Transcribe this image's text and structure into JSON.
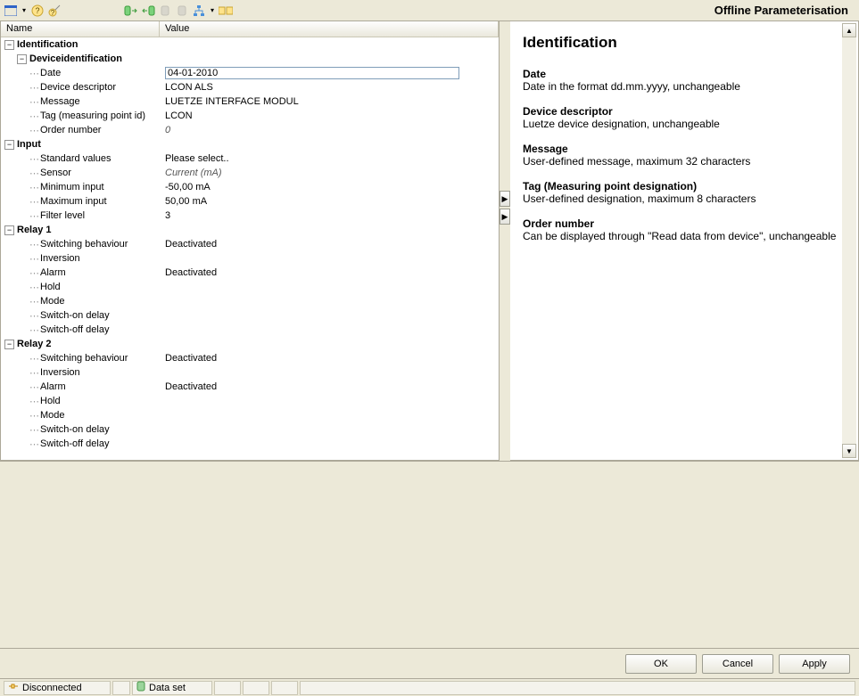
{
  "window": {
    "title": "Offline Parameterisation"
  },
  "columns": {
    "name": "Name",
    "value": "Value"
  },
  "tree": {
    "identification": {
      "label": "Identification",
      "devid": {
        "label": "Deviceidentification",
        "date": {
          "label": "Date",
          "value": "04-01-2010"
        },
        "descriptor": {
          "label": "Device descriptor",
          "value": "LCON ALS"
        },
        "message": {
          "label": "Message",
          "value": "LUETZE INTERFACE MODUL"
        },
        "tag": {
          "label": "Tag (measuring point id)",
          "value": "LCON"
        },
        "order": {
          "label": "Order number",
          "value": "0"
        }
      }
    },
    "input": {
      "label": "Input",
      "std": {
        "label": "Standard values",
        "value": "Please select.."
      },
      "sensor": {
        "label": "Sensor",
        "value": "Current (mA)"
      },
      "min": {
        "label": "Minimum input",
        "value": "-50,00 mA"
      },
      "max": {
        "label": "Maximum input",
        "value": "50,00 mA"
      },
      "filter": {
        "label": "Filter level",
        "value": "3"
      }
    },
    "relay1": {
      "label": "Relay 1",
      "switching": {
        "label": "Switching behaviour",
        "value": "Deactivated"
      },
      "inversion": {
        "label": "Inversion",
        "value": ""
      },
      "alarm": {
        "label": "Alarm",
        "value": "Deactivated"
      },
      "hold": {
        "label": "Hold",
        "value": ""
      },
      "mode": {
        "label": "Mode",
        "value": ""
      },
      "ondelay": {
        "label": "Switch-on delay",
        "value": ""
      },
      "offdelay": {
        "label": "Switch-off delay",
        "value": ""
      }
    },
    "relay2": {
      "label": "Relay 2",
      "switching": {
        "label": "Switching behaviour",
        "value": "Deactivated"
      },
      "inversion": {
        "label": "Inversion",
        "value": ""
      },
      "alarm": {
        "label": "Alarm",
        "value": "Deactivated"
      },
      "hold": {
        "label": "Hold",
        "value": ""
      },
      "mode": {
        "label": "Mode",
        "value": ""
      },
      "ondelay": {
        "label": "Switch-on delay",
        "value": ""
      },
      "offdelay": {
        "label": "Switch-off delay",
        "value": ""
      }
    }
  },
  "help": {
    "heading": "Identification",
    "items": {
      "date": {
        "title": "Date",
        "body": "Date in the format dd.mm.yyyy, unchangeable"
      },
      "descriptor": {
        "title": "Device descriptor",
        "body": "Luetze device designation, unchangeable"
      },
      "message": {
        "title": "Message",
        "body": "User-defined message, maximum 32 characters"
      },
      "tag": {
        "title": "Tag (Measuring point designation)",
        "body": "User-defined designation, maximum 8 characters"
      },
      "order": {
        "title": "Order number",
        "body": "Can be displayed through \"Read data from device\", unchangeable"
      }
    }
  },
  "buttons": {
    "ok": "OK",
    "cancel": "Cancel",
    "apply": "Apply"
  },
  "status": {
    "connection": "Disconnected",
    "dataset": "Data set"
  }
}
